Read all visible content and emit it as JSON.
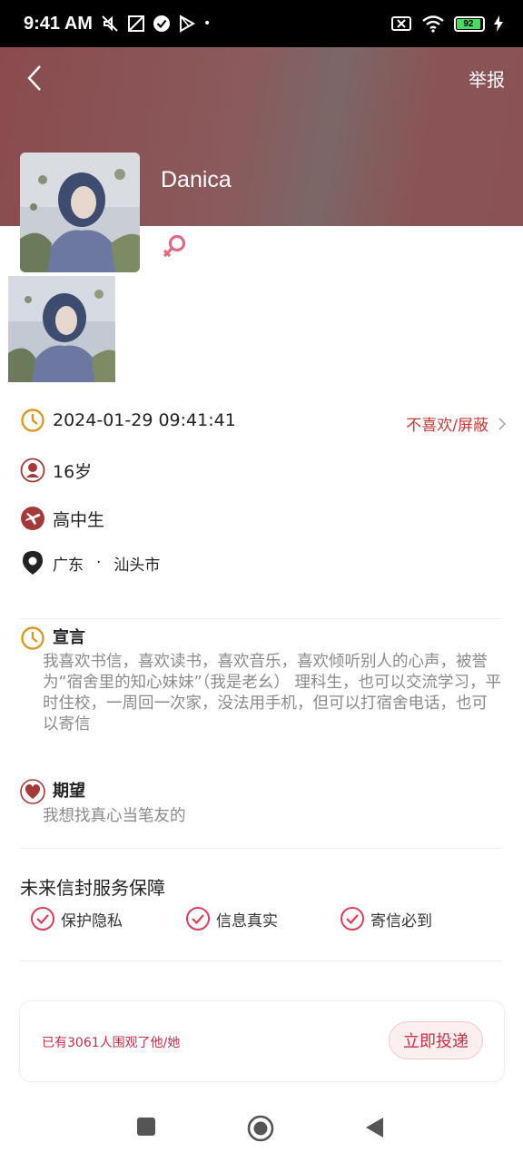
{
  "status_bar": {
    "time": "9:41 AM",
    "battery": "92"
  },
  "header": {
    "report_label": "举报",
    "back_icon": "chevron-left-icon"
  },
  "profile": {
    "nickname": "Danica",
    "gender_icon": "female-icon"
  },
  "info": {
    "timestamp": "2024-01-29 09:41:41",
    "dislike_label": "不喜欢/屏蔽",
    "age": "16岁",
    "occupation": "高中生",
    "province": "广东",
    "separator": "·",
    "city": "汕头市"
  },
  "declaration": {
    "title": "宣言",
    "text": "我喜欢书信，喜欢读书，喜欢音乐，喜欢倾听别人的心声，被誉为“宿舍里的知心妹妹”（我是老幺） 理科生，也可以交流学习，平时住校，一周回一次家，没法用手机，但可以打宿舍电话，也可以寄信"
  },
  "expectation": {
    "title": "期望",
    "text": "我想找真心当笔友的"
  },
  "guarantee": {
    "title": "未来信封服务保障",
    "items": [
      "保护隐私",
      "信息真实",
      "寄信必到"
    ]
  },
  "footer_card": {
    "viewers_text": "已有3061人围观了他/她",
    "send_label": "立即投递"
  },
  "colors": {
    "accent": "#c8304a",
    "header": "#8a5456",
    "icon_gold": "#d49a2a"
  }
}
